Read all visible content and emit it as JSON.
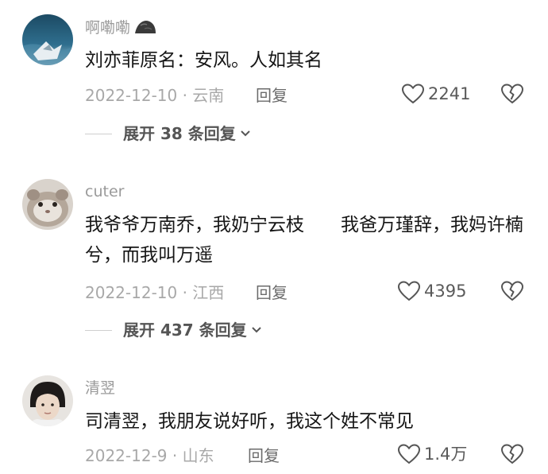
{
  "comments": [
    {
      "username": "啊嘞嘞",
      "badge_icon": "rock-badge-icon",
      "text": "刘亦菲原名：安风。人如其名",
      "date_location": "2022-12-10 · 云南",
      "reply_label": "回复",
      "like_count": "2241",
      "expand_label": "展开 38 条回复"
    },
    {
      "username": "cuter",
      "text": "我爷爷万南乔，我奶宁云枝　　我爸万瑾辞，我妈许楠兮，而我叫万遥",
      "date_location": "2022-12-10 · 江西",
      "reply_label": "回复",
      "like_count": "4395",
      "expand_label": "展开 437 条回复"
    },
    {
      "username": "清翌",
      "text": "司清翌，我朋友说好听，我这个姓不常见",
      "date_location": "2022-12-9 · 山东",
      "reply_label": "回复",
      "like_count": "1.4万"
    }
  ],
  "icons": {
    "like": "heart-outline-icon",
    "dislike": "broken-heart-icon",
    "expand": "chevron-down-icon"
  },
  "colors": {
    "text": "#161616",
    "meta": "#a8a8a8",
    "username": "#9a9a9a"
  }
}
